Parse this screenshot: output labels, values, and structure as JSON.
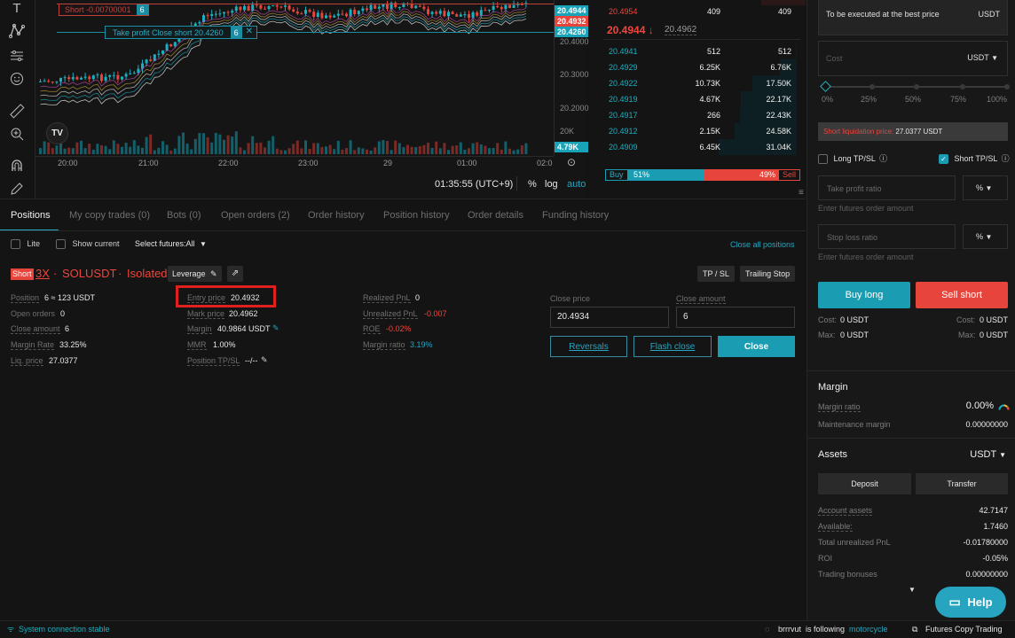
{
  "chart": {
    "short_label": "Short -0.00700001",
    "short_qty": "6",
    "tp_label": "Take profit Close short 20.4260",
    "tp_qty": "6",
    "price_ticks": [
      "20.4000",
      "20.3000",
      "20.2000",
      "20K"
    ],
    "price_tags": [
      {
        "text": "20.4944",
        "color": "#19a3b8"
      },
      {
        "text": "20.4932",
        "color": "#e7453c"
      },
      {
        "text": "20.4260",
        "color": "#19a3b8"
      }
    ],
    "volume_tag": "4.79K",
    "time_ticks": [
      "20:00",
      "21:00",
      "22:00",
      "23:00",
      "29",
      "01:00",
      "02:0"
    ],
    "clock": "01:35:55 (UTC+9)",
    "pct": "%",
    "log": "log",
    "auto": "auto"
  },
  "orderbook": {
    "ask_row": {
      "price": "20.4954",
      "qty": "409",
      "total": "409"
    },
    "last_price": "20.4944 ↓",
    "mark_price": "20.4962",
    "bids": [
      {
        "price": "20.4941",
        "qty": "512",
        "total": "512"
      },
      {
        "price": "20.4929",
        "qty": "6.25K",
        "total": "6.76K"
      },
      {
        "price": "20.4922",
        "qty": "10.73K",
        "total": "17.50K"
      },
      {
        "price": "20.4919",
        "qty": "4.67K",
        "total": "22.17K"
      },
      {
        "price": "20.4917",
        "qty": "266",
        "total": "22.43K"
      },
      {
        "price": "20.4912",
        "qty": "2.15K",
        "total": "24.58K"
      },
      {
        "price": "20.4909",
        "qty": "6.45K",
        "total": "31.04K"
      }
    ],
    "buy_label": "Buy",
    "buy_pct": "51%",
    "buy_ratio": 0.51,
    "sell_pct": "49%",
    "sell_label": "Sell"
  },
  "positions": {
    "tabs": [
      "Positions",
      "My copy trades (0)",
      "Bots (0)",
      "Open orders (2)",
      "Order history",
      "Position history",
      "Order details",
      "Funding history"
    ],
    "lite": "Lite",
    "show_current": "Show current",
    "select_futures": "Select futures:All",
    "close_all": "Close all positions",
    "side_badge": "Short",
    "leverage_x": "3X",
    "sep": "·",
    "symbol": "SOLUSDT",
    "margin_mode": "Isolated",
    "leverage_btn": "Leverage",
    "tp_sl_btn": "TP / SL",
    "trailing_btn": "Trailing Stop",
    "col1": [
      {
        "label": "Position",
        "value": "6 ≈ 123 USDT"
      },
      {
        "label": "Open orders",
        "value": "0"
      },
      {
        "label": "Close amount",
        "value": "6"
      },
      {
        "label": "Margin Rate",
        "value": "33.25%"
      },
      {
        "label": "Liq. price",
        "value": "27.0377"
      }
    ],
    "col2": [
      {
        "label": "Entry price",
        "value": "20.4932"
      },
      {
        "label": "Mark price",
        "value": "20.4962"
      },
      {
        "label": "Margin",
        "value": "40.9864 USDT"
      },
      {
        "label": "MMR",
        "value": "1.00%"
      },
      {
        "label": "Position TP/SL",
        "value": "--/--"
      }
    ],
    "col3": [
      {
        "label": "Realized PnL",
        "value": "0"
      },
      {
        "label": "Unrealized PnL",
        "value": "-0.007"
      },
      {
        "label": "ROE",
        "value": "-0.02%"
      },
      {
        "label": "Margin ratio",
        "value": "3.19%"
      }
    ],
    "close_price_label": "Close price",
    "close_amount_label": "Close amount",
    "close_price_value": "20.4934",
    "close_amount_value": "6",
    "reversals": "Reversals",
    "flash_close": "Flash close",
    "close": "Close"
  },
  "order_panel": {
    "exec_text": "To be executed at the best price",
    "exec_unit": "USDT",
    "cost_placeholder": "Cost",
    "cost_unit": "USDT",
    "slider_ticks": [
      "0%",
      "25%",
      "50%",
      "75%",
      "100%"
    ],
    "liq_label": "Short liquidation price:",
    "liq_value": "27.0377 USDT",
    "long_tpsl": "Long TP/SL",
    "short_tpsl": "Short TP/SL",
    "tp_placeholder": "Take profit ratio",
    "tp_unit": "%",
    "tp_hint": "Enter futures order amount",
    "sl_placeholder": "Stop loss ratio",
    "sl_unit": "%",
    "sl_hint": "Enter futures order amount",
    "buy_long": "Buy long",
    "sell_short": "Sell short",
    "cost_left_label": "Cost:",
    "cost_left_value": "0 USDT",
    "cost_right_label": "Cost:",
    "cost_right_value": "0 USDT",
    "max_left_label": "Max:",
    "max_left_value": "0 USDT",
    "max_right_label": "Max:",
    "max_right_value": "0 USDT"
  },
  "margin": {
    "title": "Margin",
    "ratio_label": "Margin ratio",
    "ratio_value": "0.00%",
    "maint_label": "Maintenance margin",
    "maint_value": "0.00000000"
  },
  "assets": {
    "title": "Assets",
    "unit": "USDT",
    "deposit": "Deposit",
    "transfer": "Transfer",
    "rows": [
      {
        "label": "Account assets",
        "value": "42.7147"
      },
      {
        "label": "Available:",
        "value": "1.7460"
      },
      {
        "label": "Total unrealized PnL",
        "value": "-0.01780000"
      },
      {
        "label": "ROI",
        "value": "-0.05%"
      },
      {
        "label": "Trading bonuses",
        "value": "0.00000000"
      }
    ],
    "help": "Help"
  },
  "status": {
    "connection": "System connection stable",
    "user": "brrrvut",
    "following": "is following",
    "target": "motorcycle",
    "copy": "Futures Copy Trading"
  }
}
